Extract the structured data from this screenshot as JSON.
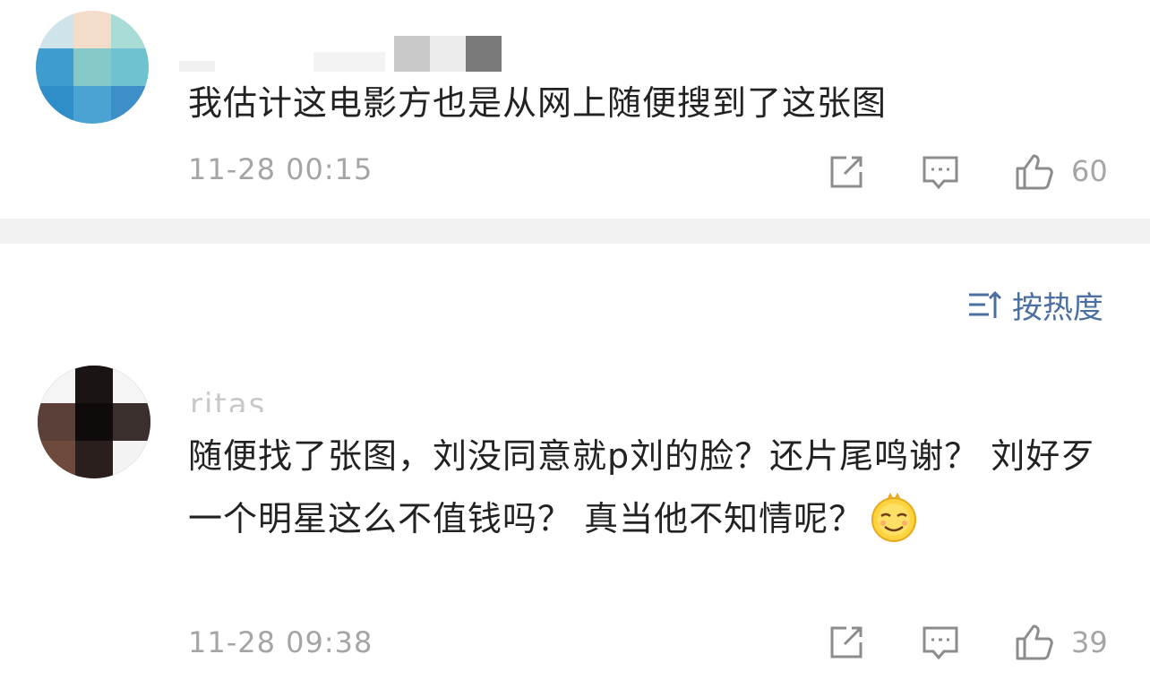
{
  "comments": [
    {
      "username": "",
      "text": "我估计这电影方也是从网上随便搜到了这张图",
      "timestamp": "11-28 00:15",
      "likes": "60"
    },
    {
      "username": "ritas",
      "text": "随便找了张图，刘没同意就p刘的脸？还片尾鸣谢？ 刘好歹一个明星这么不值钱吗？ 真当他不知情呢？",
      "emoji": "smirk-emoji",
      "timestamp": "11-28 09:38",
      "likes": "39"
    }
  ],
  "sort": {
    "label": "按热度",
    "icon": "sort-icon"
  },
  "icons": {
    "repost": "repost-icon",
    "reply": "comment-icon",
    "like": "thumbs-up-icon"
  },
  "colors": {
    "accent": "#4a6fa0",
    "muted": "#a5a5a5",
    "divider": "#f2f2f2"
  }
}
